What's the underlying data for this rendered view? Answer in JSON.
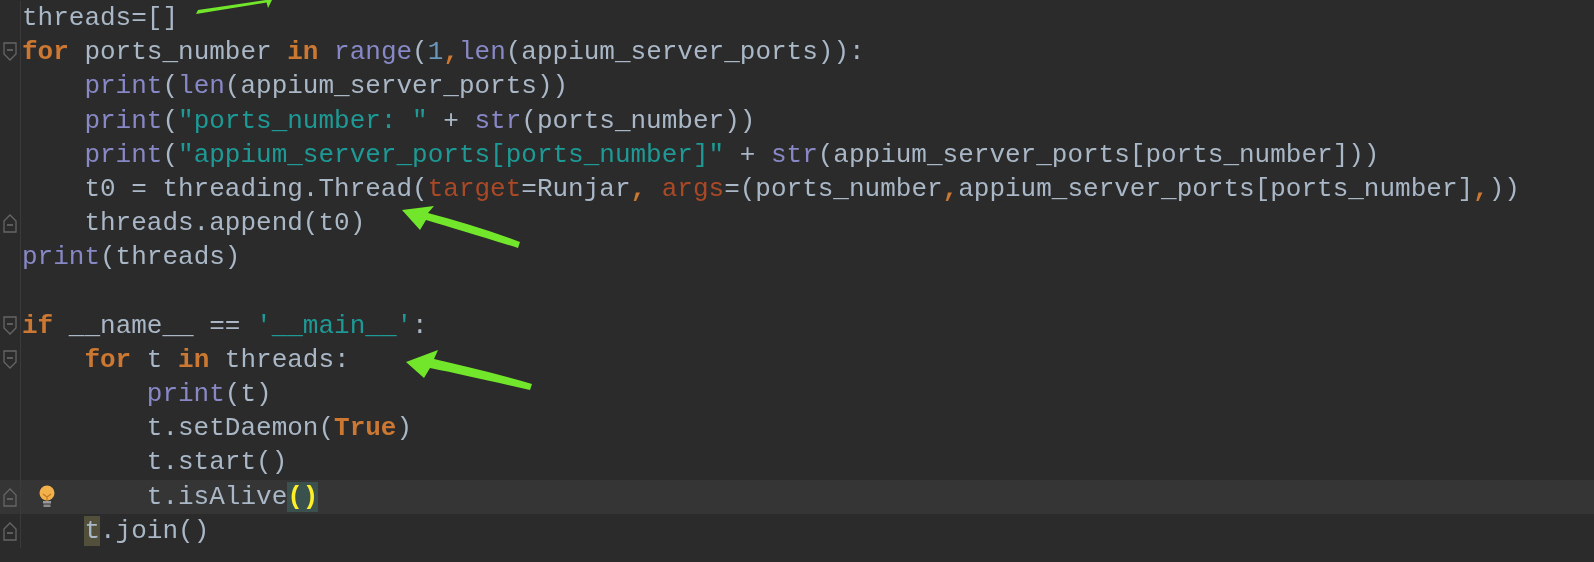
{
  "editor": {
    "lines": [
      {
        "kind": "code",
        "tokens": [
          {
            "text": "threads=[]",
            "kind": "plain"
          }
        ]
      },
      {
        "kind": "code",
        "tokens": [
          {
            "text": "for",
            "kind": "keyword"
          },
          {
            "text": " ports_number ",
            "kind": "plain"
          },
          {
            "text": "in",
            "kind": "keyword"
          },
          {
            "text": " range",
            "kind": "builtin"
          },
          {
            "text": "(",
            "kind": "plain"
          },
          {
            "text": "1",
            "kind": "number"
          },
          {
            "text": ",",
            "kind": "keyword"
          },
          {
            "text": "len",
            "kind": "builtin"
          },
          {
            "text": "(appium_server_ports)):",
            "kind": "plain"
          }
        ],
        "children": [
          {
            "kind": "code",
            "tokens": [
              {
                "text": "print",
                "kind": "builtin"
              },
              {
                "text": "(",
                "kind": "plain"
              },
              {
                "text": "len",
                "kind": "builtin"
              },
              {
                "text": "(appium_server_ports))",
                "kind": "plain"
              }
            ]
          },
          {
            "kind": "code",
            "tokens": [
              {
                "text": "print",
                "kind": "builtin"
              },
              {
                "text": "(",
                "kind": "plain"
              },
              {
                "text": "\"ports_number: \"",
                "kind": "string"
              },
              {
                "text": " + ",
                "kind": "plain"
              },
              {
                "text": "str",
                "kind": "builtin"
              },
              {
                "text": "(ports_number))",
                "kind": "plain"
              }
            ]
          },
          {
            "kind": "code",
            "tokens": [
              {
                "text": "print",
                "kind": "builtin"
              },
              {
                "text": "(",
                "kind": "plain"
              },
              {
                "text": "\"appium_server_ports[ports_number]\"",
                "kind": "string"
              },
              {
                "text": " + ",
                "kind": "plain"
              },
              {
                "text": "str",
                "kind": "builtin"
              },
              {
                "text": "(appium_server_ports[ports_number]))",
                "kind": "plain"
              }
            ]
          },
          {
            "kind": "code",
            "tokens": [
              {
                "text": "t0 = threading.Thread(",
                "kind": "plain"
              },
              {
                "text": "target",
                "kind": "param"
              },
              {
                "text": "=Runjar",
                "kind": "plain"
              },
              {
                "text": ", ",
                "kind": "keyword"
              },
              {
                "text": "args",
                "kind": "param"
              },
              {
                "text": "=(ports_number",
                "kind": "plain"
              },
              {
                "text": ",",
                "kind": "keyword"
              },
              {
                "text": "appium_server_ports[ports_number]",
                "kind": "plain"
              },
              {
                "text": ",",
                "kind": "keyword"
              },
              {
                "text": "))",
                "kind": "plain"
              }
            ]
          },
          {
            "kind": "code",
            "tokens": [
              {
                "text": "threads.append(t0)",
                "kind": "plain"
              }
            ]
          }
        ]
      },
      {
        "kind": "code",
        "tokens": [
          {
            "text": "print",
            "kind": "builtin"
          },
          {
            "text": "(threads)",
            "kind": "plain"
          }
        ]
      },
      {
        "kind": "blank"
      },
      {
        "kind": "code",
        "tokens": [
          {
            "text": "if",
            "kind": "keyword"
          },
          {
            "text": " __name__ == ",
            "kind": "plain"
          },
          {
            "text": "'__main__'",
            "kind": "string"
          },
          {
            "text": ":",
            "kind": "plain"
          }
        ],
        "children": [
          {
            "kind": "code",
            "tokens": [
              {
                "text": "for",
                "kind": "keyword"
              },
              {
                "text": " t ",
                "kind": "plain"
              },
              {
                "text": "in",
                "kind": "keyword"
              },
              {
                "text": " threads:",
                "kind": "plain"
              }
            ],
            "children": [
              {
                "kind": "code",
                "tokens": [
                  {
                    "text": "print",
                    "kind": "builtin"
                  },
                  {
                    "text": "(t)",
                    "kind": "plain"
                  }
                ]
              },
              {
                "kind": "code",
                "tokens": [
                  {
                    "text": "t.setDaemon(",
                    "kind": "plain"
                  },
                  {
                    "text": "True",
                    "kind": "keyword"
                  },
                  {
                    "text": ")",
                    "kind": "plain"
                  }
                ]
              },
              {
                "kind": "code",
                "tokens": [
                  {
                    "text": "t.start()",
                    "kind": "plain"
                  }
                ]
              },
              {
                "kind": "code",
                "current": true,
                "intention": true,
                "tokens": [
                  {
                    "text": "t.isAlive",
                    "kind": "plain"
                  },
                  {
                    "text": "()",
                    "kind": "match"
                  }
                ]
              }
            ]
          },
          {
            "kind": "code",
            "tokens": [
              {
                "text": "t",
                "kind": "usage"
              },
              {
                "text": ".join()",
                "kind": "plain"
              }
            ]
          }
        ]
      }
    ]
  }
}
